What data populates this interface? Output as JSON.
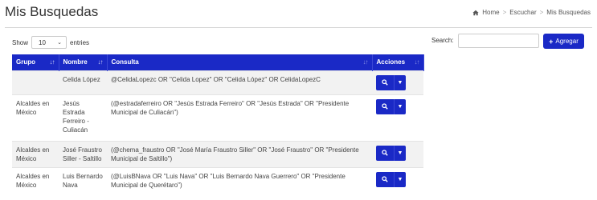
{
  "page": {
    "title": "Mis Busquedas"
  },
  "breadcrumb": {
    "home": "Home",
    "escuchar": "Escuchar",
    "current": "Mis Busquedas"
  },
  "controls": {
    "show_label": "Show",
    "page_size": "10",
    "entries_label": "entries",
    "search_label": "Search:",
    "search_value": "",
    "add_button": "Agregar"
  },
  "table": {
    "headers": {
      "grupo": "Grupo",
      "nombre": "Nombre",
      "consulta": "Consulta",
      "acciones": "Acciones"
    },
    "rows": [
      {
        "grupo": "",
        "nombre": "Celida López",
        "consulta": "@CelidaLopezc OR \"Celida Lopez\" OR \"Celida López\" OR CelidaLopezC"
      },
      {
        "grupo": "Alcaldes en México",
        "nombre": "Jesús Estrada Ferreiro - Culiacán",
        "consulta": "(@estradaferreiro OR \"Jesús Estrada Ferreiro\" OR \"Jesús Estrada\" OR \"Presidente Municipal de Culiacán\")"
      },
      {
        "grupo": "Alcaldes en México",
        "nombre": "José Fraustro Siller - Saltillo",
        "consulta": "(@chema_fraustro OR \"José María Fraustro Siller\" OR \"José Fraustro\" OR \"Presidente Municipal de Saltillo\")"
      },
      {
        "grupo": "Alcaldes en México",
        "nombre": "Luis Bernardo Nava",
        "consulta": "(@LuisBNava OR \"Luis Nava\" OR \"Luis Bernardo Nava Guerrero\" OR \"Presidente Municipal de Querétaro\")"
      }
    ]
  },
  "colors": {
    "accent": "#1a29c6"
  }
}
